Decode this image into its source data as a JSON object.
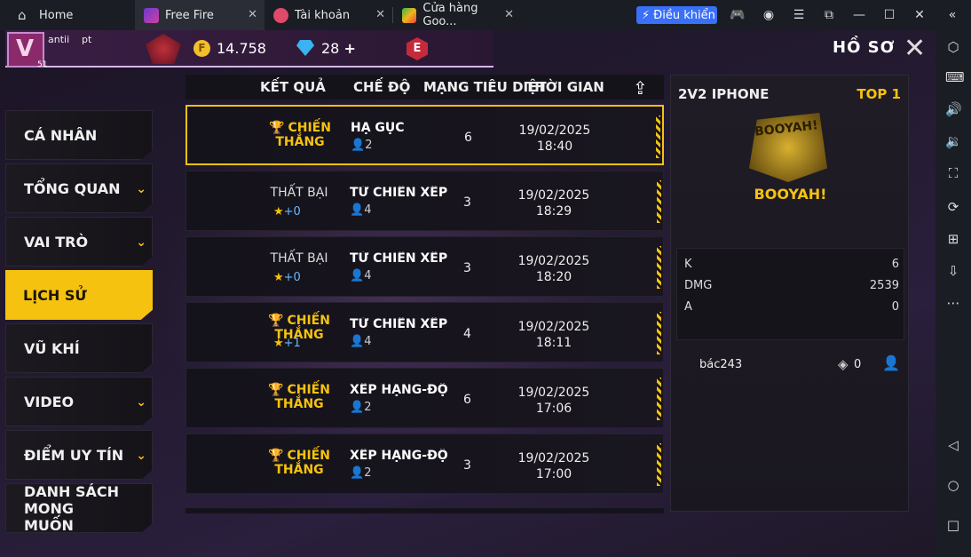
{
  "tabs": [
    {
      "label": "Home",
      "icon": "home-icon"
    },
    {
      "label": "Free Fire",
      "icon": "free-fire-icon"
    },
    {
      "label": "Tài khoản",
      "icon": "account-icon"
    },
    {
      "label": "Cửa hàng Goo...",
      "icon": "play-store-icon"
    }
  ],
  "toolbar": {
    "control_label": "Điều khiển"
  },
  "player": {
    "name": "antii",
    "clan": "pt",
    "level": "51",
    "avatar_letter": "V"
  },
  "currency": {
    "coins": "14.758",
    "diamonds": "28",
    "diamond_plus": "+",
    "event_letter": "E"
  },
  "page_title": "HỒ SƠ",
  "menu": [
    {
      "label": "CÁ NHÂN",
      "chevron": false
    },
    {
      "label": "TỔNG QUAN",
      "chevron": true
    },
    {
      "label": "VAI TRÒ",
      "chevron": true
    },
    {
      "label": "LỊCH SỬ",
      "chevron": false,
      "active": true
    },
    {
      "label": "VŨ KHÍ",
      "chevron": false
    },
    {
      "label": "VIDEO",
      "chevron": true
    },
    {
      "label": "ĐIỂM UY TÍN",
      "chevron": true
    },
    {
      "label": "DANH SÁCH MONG MUỐN",
      "chevron": false
    }
  ],
  "table": {
    "headers": [
      "KẾT QUẢ",
      "CHẾ ĐỘ",
      "MẠNG TIÊU DIỆT",
      "THỜI GIAN"
    ],
    "rows": [
      {
        "result": "CHIẾN THẮNG",
        "win": true,
        "stars": "",
        "mode": "HẠ GỤC",
        "players": "2",
        "kills": "6",
        "date": "19/02/2025",
        "time": "18:40"
      },
      {
        "result": "THẤT BẠI",
        "win": false,
        "stars": "+0",
        "mode": "TỬ CHIẾN XẾP HẠ",
        "players": "4",
        "kills": "3",
        "date": "19/02/2025",
        "time": "18:29"
      },
      {
        "result": "THẤT BẠI",
        "win": false,
        "stars": "+0",
        "mode": "TỬ CHIẾN XẾP HẠ",
        "players": "4",
        "kills": "3",
        "date": "19/02/2025",
        "time": "18:20"
      },
      {
        "result": "CHIẾN THẮNG",
        "win": true,
        "stars": "+1",
        "mode": "TỬ CHIẾN XẾP HẠ",
        "players": "4",
        "kills": "4",
        "date": "19/02/2025",
        "time": "18:11"
      },
      {
        "result": "CHIẾN THẮNG",
        "win": true,
        "stars": "",
        "mode": "XẾP HẠNG-ĐỘC L",
        "players": "2",
        "kills": "6",
        "date": "19/02/2025",
        "time": "17:06"
      },
      {
        "result": "CHIẾN THẮNG",
        "win": true,
        "stars": "",
        "mode": "XẾP HẠNG-ĐỘC L",
        "players": "2",
        "kills": "3",
        "date": "19/02/2025",
        "time": "17:00"
      }
    ]
  },
  "detail": {
    "title": "2V2 IPHONE",
    "rank": "TOP 1",
    "booyah_art": "BOOYAH!",
    "booyah_label": "BOOYAH!",
    "stats": [
      {
        "label": "K",
        "value": "6"
      },
      {
        "label": "DMG",
        "value": "2539"
      },
      {
        "label": "A",
        "value": "0"
      }
    ],
    "teammate": {
      "name": "bác243",
      "value": "0"
    }
  },
  "colors": {
    "accent": "#f5c20f",
    "brand_blue": "#3a6ff7"
  }
}
